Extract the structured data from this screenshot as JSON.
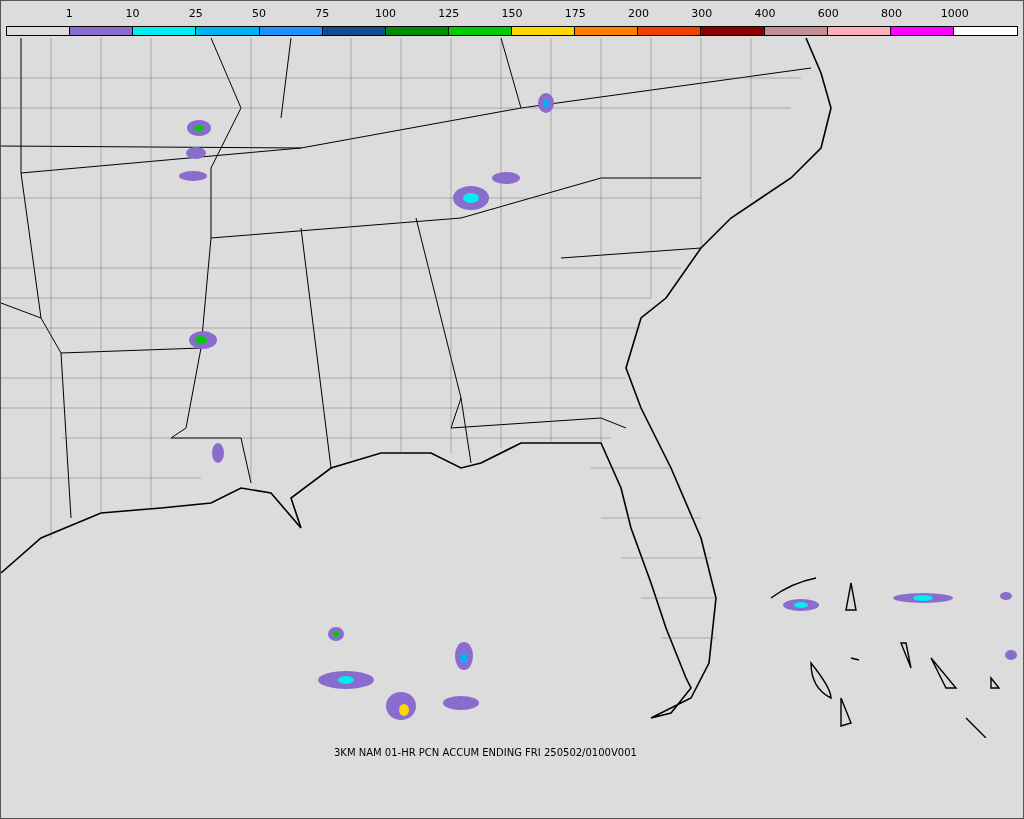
{
  "legend": {
    "bins": [
      {
        "color": "#dcdcdc",
        "label": "1"
      },
      {
        "color": "#8a6ccf",
        "label": "10"
      },
      {
        "color": "#00eeee",
        "label": "25"
      },
      {
        "color": "#00b2ee",
        "label": "50"
      },
      {
        "color": "#1e90ff",
        "label": "75"
      },
      {
        "color": "#104e8b",
        "label": "100"
      },
      {
        "color": "#008b00",
        "label": "125"
      },
      {
        "color": "#00cd00",
        "label": "150"
      },
      {
        "color": "#ffd700",
        "label": "175"
      },
      {
        "color": "#ff7f00",
        "label": "200"
      },
      {
        "color": "#ee4000",
        "label": "300"
      },
      {
        "color": "#8b0000",
        "label": "400"
      },
      {
        "color": "#c48e96",
        "label": "600"
      },
      {
        "color": "#ffaebb",
        "label": "800"
      },
      {
        "color": "#ff00ff",
        "label": "1000"
      },
      {
        "color": "#ffffff"
      }
    ]
  },
  "caption": "3KM NAM 01-HR PCN ACCUM ENDING FRI 250502/0100V001"
}
